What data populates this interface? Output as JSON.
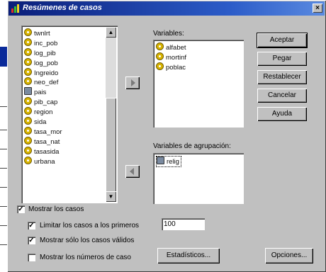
{
  "window": {
    "title": "Resúmenes de casos",
    "close_label": "×"
  },
  "source_list": {
    "items": [
      {
        "label": "twnlrt",
        "type": "num"
      },
      {
        "label": "inc_pob",
        "type": "num"
      },
      {
        "label": "log_pib",
        "type": "num"
      },
      {
        "label": "log_pob",
        "type": "num"
      },
      {
        "label": "Ingreido",
        "type": "num"
      },
      {
        "label": "neo_def",
        "type": "num"
      },
      {
        "label": "pais",
        "type": "str"
      },
      {
        "label": "pib_cap",
        "type": "num"
      },
      {
        "label": "region",
        "type": "num"
      },
      {
        "label": "sida",
        "type": "num"
      },
      {
        "label": "tasa_mor",
        "type": "num"
      },
      {
        "label": "tasa_nat",
        "type": "num"
      },
      {
        "label": "tasasida",
        "type": "num"
      },
      {
        "label": "urbana",
        "type": "num"
      }
    ]
  },
  "variables": {
    "label": "Variables:",
    "items": [
      {
        "label": "alfabet",
        "type": "num"
      },
      {
        "label": "mortinf",
        "type": "num"
      },
      {
        "label": "poblac",
        "type": "num"
      }
    ]
  },
  "grouping": {
    "label": "Variables de agrupación:",
    "items": [
      {
        "label": "relig",
        "type": "str"
      }
    ]
  },
  "buttons": {
    "accept": "Aceptar",
    "paste": "Pegar",
    "reset": "Restablecer",
    "cancel": "Cancelar",
    "help": "Ayuda",
    "statistics": "Estadísticos...",
    "options": "Opciones..."
  },
  "options": {
    "show_cases": {
      "label": "Mostrar los casos",
      "checked": true
    },
    "limit_cases": {
      "label": "Limitar los casos a los primeros",
      "checked": true,
      "value": "100"
    },
    "valid_only": {
      "label": "Mostrar sólo los casos válidos",
      "checked": true
    },
    "case_numbers": {
      "label": "Mostrar los números de caso",
      "checked": false
    }
  }
}
